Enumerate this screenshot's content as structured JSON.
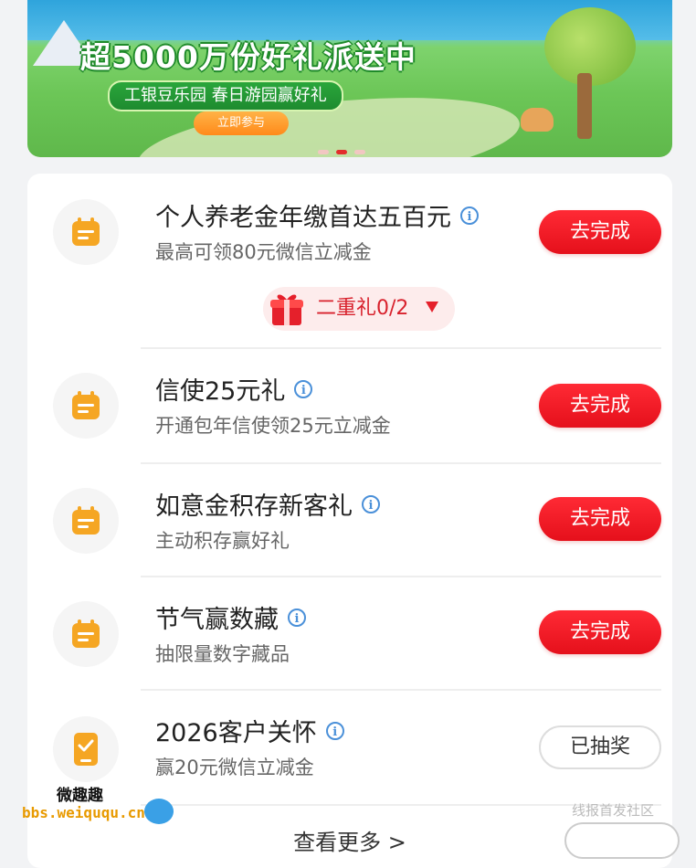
{
  "banner": {
    "headline": "超5000万份好礼派送中",
    "subtitle": "工银豆乐园 春日游园赢好礼",
    "cta_label": "立即参与",
    "page_dots": 3,
    "active_dot": 2
  },
  "tasks": [
    {
      "title": "个人养老金年缴首达五百元",
      "subtitle": "最高可领80元微信立减金",
      "button": "去完成",
      "status": "todo",
      "icon": "calendar-icon"
    },
    {
      "title": "信使25元礼",
      "subtitle": "开通包年信使领25元立减金",
      "button": "去完成",
      "status": "todo",
      "icon": "calendar-icon"
    },
    {
      "title": "如意金积存新客礼",
      "subtitle": "主动积存赢好礼",
      "button": "去完成",
      "status": "todo",
      "icon": "calendar-icon"
    },
    {
      "title": "节气赢数藏",
      "subtitle": "抽限量数字藏品",
      "button": "去完成",
      "status": "todo",
      "icon": "calendar-icon"
    },
    {
      "title": "2026客户关怀",
      "subtitle": "赢20元微信立减金",
      "button": "已抽奖",
      "status": "done",
      "icon": "phone-check-icon"
    }
  ],
  "gift_badge": {
    "label": "二重礼0/2"
  },
  "more_label": "查看更多 >",
  "watermark": {
    "line1": "微趣趣",
    "line2": "bbs.weiququ.cn"
  },
  "corner_text": "线报首发社区",
  "colors": {
    "accent": "#e5101b",
    "icon_orange": "#f5a623",
    "info_blue": "#4a90d9"
  }
}
